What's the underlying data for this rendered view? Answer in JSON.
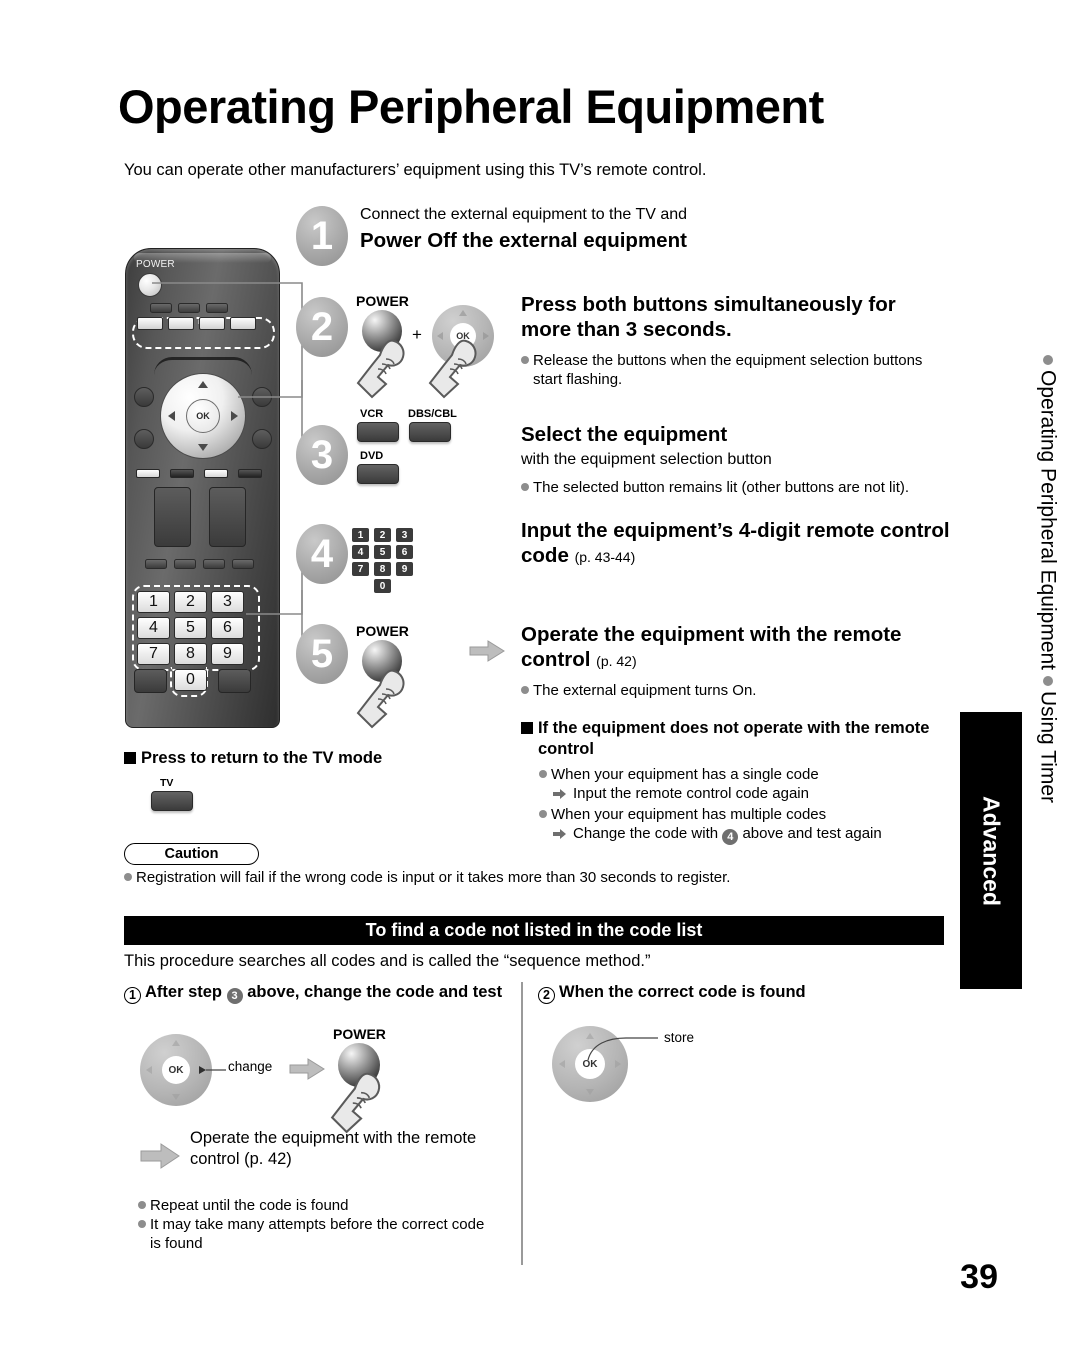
{
  "page": {
    "title": "Operating Peripheral Equipment",
    "intro": "You can operate other manufacturers’ equipment using this TV’s remote control.",
    "number": "39"
  },
  "side_tab": {
    "line1": "Operating Peripheral Equipment",
    "line2": "Using Timer",
    "category": "Advanced"
  },
  "remote": {
    "power_label": "POWER",
    "equipment_buttons": [
      "TV",
      "VCR",
      "DBS/CBL",
      "DVD"
    ],
    "ok_label": "OK",
    "keys": [
      "1",
      "2",
      "3",
      "4",
      "5",
      "6",
      "7",
      "8",
      "9",
      "0"
    ]
  },
  "steps": [
    {
      "num": "1",
      "lead": "Connect the external equipment to the TV and",
      "heading": "Power Off the external equipment",
      "bullets": []
    },
    {
      "num": "2",
      "power_label": "POWER",
      "plus": "+",
      "ok_label": "OK",
      "heading": "Press both buttons simultaneously for more than 3 seconds.",
      "bullets": [
        "Release the buttons when the equipment selection buttons start flashing."
      ]
    },
    {
      "num": "3",
      "buttons": [
        "VCR",
        "DBS/CBL",
        "DVD"
      ],
      "heading": "Select the equipment",
      "sub": "with the equipment selection button",
      "bullets": [
        "The selected button remains lit (other buttons are not lit)."
      ]
    },
    {
      "num": "4",
      "keys": [
        "1",
        "2",
        "3",
        "4",
        "5",
        "6",
        "7",
        "8",
        "9",
        "0"
      ],
      "heading": "Input the equipment’s 4-digit remote control code",
      "heading_ref": "(p. 43-44)",
      "bullets": []
    },
    {
      "num": "5",
      "power_label": "POWER",
      "heading": "Operate the equipment with the remote control",
      "heading_ref": "(p. 42)",
      "bullets": [
        "The external equipment turns On."
      ]
    }
  ],
  "trouble": {
    "heading": "If the equipment does not operate with the remote control",
    "items": [
      {
        "bullet": "When your equipment has a single code",
        "arrow": "Input the remote control code again"
      },
      {
        "bullet": "When your equipment has multiple codes",
        "arrow_pre": "Change the code with",
        "arrow_num": "4",
        "arrow_post": "above and test again"
      }
    ]
  },
  "return_tv": {
    "heading": "Press to return to the TV mode",
    "button_label": "TV"
  },
  "caution": {
    "label": "Caution",
    "text": "Registration will fail if the wrong code is input or it takes more than 30 seconds to register."
  },
  "code_search": {
    "bar_title": "To find a code not listed in the code list",
    "intro": "This procedure searches all codes and is called the “sequence method.”",
    "left": {
      "num": "1",
      "heading_pre": "After step",
      "heading_step": "3",
      "heading_post": "above, change the code and test",
      "ok_label": "OK",
      "change_label": "change",
      "power_label": "POWER",
      "result": "Operate the equipment with the remote control (p. 42)",
      "notes": [
        "Repeat until the code is found",
        "It may take many attempts before the correct code is found"
      ]
    },
    "right": {
      "num": "2",
      "heading": "When the correct code is found",
      "ok_label": "OK",
      "store_label": "store"
    }
  }
}
